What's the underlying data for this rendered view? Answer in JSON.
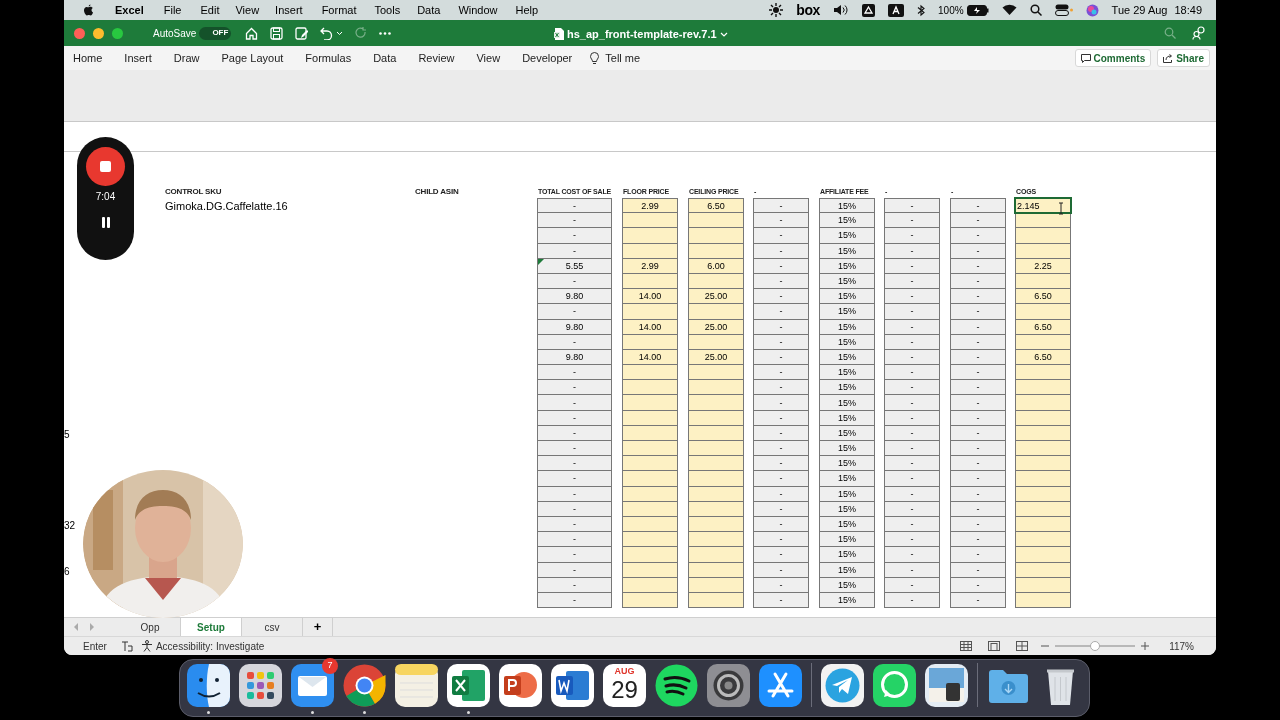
{
  "menu_bar": {
    "app": "Excel",
    "items": [
      "File",
      "Edit",
      "View",
      "Insert",
      "Format",
      "Tools",
      "Data",
      "Window",
      "Help"
    ],
    "status": {
      "box": "box",
      "battery": "100%",
      "date": "Tue 29 Aug",
      "time": "18:49"
    }
  },
  "title_bar": {
    "autosave_label": "AutoSave",
    "autosave_on": false,
    "autosave_state": "OFF",
    "title": "hs_ap_front-template-rev.7.1"
  },
  "ribbon_tabs": [
    "Home",
    "Insert",
    "Draw",
    "Page Layout",
    "Formulas",
    "Data",
    "Review",
    "View",
    "Developer"
  ],
  "tell_me": "Tell me",
  "comments_button": "Comments",
  "share_button": "Share",
  "recorder": {
    "elapsed": "7:04"
  },
  "edge_marks": [
    {
      "text": "5"
    },
    {
      "text": "32"
    },
    {
      "text": "6"
    }
  ],
  "sku": {
    "label": "CONTROL SKU",
    "value": "Gimoka.DG.Caffelatte.16"
  },
  "child_asin": {
    "label": "CHILD ASIN"
  },
  "table": {
    "columns": [
      {
        "header": "TOTAL COST OF SALE",
        "kind": "gray"
      },
      {
        "header": "FLOOR PRICE",
        "kind": "yellow"
      },
      {
        "header": "CEILING PRICE",
        "kind": "yellow"
      },
      {
        "header": "-",
        "kind": "gray"
      },
      {
        "header": "AFFILIATE FEE",
        "kind": "gray"
      },
      {
        "header": "-",
        "kind": "gray"
      },
      {
        "header": "-",
        "kind": "gray"
      },
      {
        "header": "COGS",
        "kind": "yellow"
      }
    ],
    "rows": [
      {
        "cells": [
          "-",
          "2.99",
          "6.50",
          "-",
          "15%",
          "-",
          "-",
          "2.145"
        ],
        "selected": true,
        "flagged": false
      },
      {
        "cells": [
          "-",
          null,
          null,
          "-",
          "15%",
          "-",
          "-",
          null
        ],
        "selected": false,
        "flagged": false
      },
      {
        "cells": [
          "-",
          null,
          null,
          "-",
          "15%",
          "-",
          "-",
          null
        ],
        "selected": false,
        "flagged": false
      },
      {
        "cells": [
          "-",
          null,
          null,
          "-",
          "15%",
          "-",
          "-",
          null
        ],
        "selected": false,
        "flagged": false
      },
      {
        "cells": [
          "5.55",
          "2.99",
          "6.00",
          "-",
          "15%",
          "-",
          "-",
          "2.25"
        ],
        "selected": false,
        "flagged": true
      },
      {
        "cells": [
          "-",
          null,
          null,
          "-",
          "15%",
          "-",
          "-",
          null
        ],
        "selected": false,
        "flagged": false
      },
      {
        "cells": [
          "9.80",
          "14.00",
          "25.00",
          "-",
          "15%",
          "-",
          "-",
          "6.50"
        ],
        "selected": false,
        "flagged": false
      },
      {
        "cells": [
          "-",
          null,
          null,
          "-",
          "15%",
          "-",
          "-",
          null
        ],
        "selected": false,
        "flagged": false
      },
      {
        "cells": [
          "9.80",
          "14.00",
          "25.00",
          "-",
          "15%",
          "-",
          "-",
          "6.50"
        ],
        "selected": false,
        "flagged": false
      },
      {
        "cells": [
          "-",
          null,
          null,
          "-",
          "15%",
          "-",
          "-",
          null
        ],
        "selected": false,
        "flagged": false
      },
      {
        "cells": [
          "9.80",
          "14.00",
          "25.00",
          "-",
          "15%",
          "-",
          "-",
          "6.50"
        ],
        "selected": false,
        "flagged": false
      },
      {
        "cells": [
          "-",
          null,
          null,
          "-",
          "15%",
          "-",
          "-",
          null
        ],
        "selected": false,
        "flagged": false
      },
      {
        "cells": [
          "-",
          null,
          null,
          "-",
          "15%",
          "-",
          "-",
          null
        ],
        "selected": false,
        "flagged": false
      },
      {
        "cells": [
          "-",
          null,
          null,
          "-",
          "15%",
          "-",
          "-",
          null
        ],
        "selected": false,
        "flagged": false
      },
      {
        "cells": [
          "-",
          null,
          null,
          "-",
          "15%",
          "-",
          "-",
          null
        ],
        "selected": false,
        "flagged": false
      },
      {
        "cells": [
          "-",
          null,
          null,
          "-",
          "15%",
          "-",
          "-",
          null
        ],
        "selected": false,
        "flagged": false
      },
      {
        "cells": [
          "-",
          null,
          null,
          "-",
          "15%",
          "-",
          "-",
          null
        ],
        "selected": false,
        "flagged": false
      },
      {
        "cells": [
          "-",
          null,
          null,
          "-",
          "15%",
          "-",
          "-",
          null
        ],
        "selected": false,
        "flagged": false
      },
      {
        "cells": [
          "-",
          null,
          null,
          "-",
          "15%",
          "-",
          "-",
          null
        ],
        "selected": false,
        "flagged": false
      },
      {
        "cells": [
          "-",
          null,
          null,
          "-",
          "15%",
          "-",
          "-",
          null
        ],
        "selected": false,
        "flagged": false
      },
      {
        "cells": [
          "-",
          null,
          null,
          "-",
          "15%",
          "-",
          "-",
          null
        ],
        "selected": false,
        "flagged": false
      },
      {
        "cells": [
          "-",
          null,
          null,
          "-",
          "15%",
          "-",
          "-",
          null
        ],
        "selected": false,
        "flagged": false
      },
      {
        "cells": [
          "-",
          null,
          null,
          "-",
          "15%",
          "-",
          "-",
          null
        ],
        "selected": false,
        "flagged": false
      },
      {
        "cells": [
          "-",
          null,
          null,
          "-",
          "15%",
          "-",
          "-",
          null
        ],
        "selected": false,
        "flagged": false
      },
      {
        "cells": [
          "-",
          null,
          null,
          "-",
          "15%",
          "-",
          "-",
          null
        ],
        "selected": false,
        "flagged": false
      },
      {
        "cells": [
          "-",
          null,
          null,
          "-",
          "15%",
          "-",
          "-",
          null
        ],
        "selected": false,
        "flagged": false
      },
      {
        "cells": [
          "-",
          null,
          null,
          "-",
          "15%",
          "-",
          "-",
          null
        ],
        "selected": false,
        "flagged": false
      }
    ]
  },
  "sheet_tabs": [
    {
      "label": "Opp",
      "selected": false
    },
    {
      "label": "Setup",
      "selected": true
    },
    {
      "label": "csv",
      "selected": false
    }
  ],
  "add_sheet": "+",
  "status_bar": {
    "mode": "Enter",
    "accessibility": "Accessibility: Investigate",
    "zoom": "117%",
    "zoom_slider": {
      "level": 0.5
    }
  },
  "dock": [
    {
      "kind": "finder",
      "running": true
    },
    {
      "kind": "launchpad",
      "running": false
    },
    {
      "kind": "mail",
      "running": true,
      "badge": "7"
    },
    {
      "kind": "chrome",
      "running": true
    },
    {
      "kind": "notes",
      "running": false
    },
    {
      "kind": "excel",
      "running": true
    },
    {
      "kind": "powerpoint",
      "running": false
    },
    {
      "kind": "word",
      "running": false
    },
    {
      "kind": "calendar",
      "running": false,
      "month": "AUG",
      "day": "29"
    },
    {
      "kind": "spotify",
      "running": false
    },
    {
      "kind": "settings",
      "running": false
    },
    {
      "kind": "appstore",
      "running": false
    },
    {
      "kind": "telegram",
      "running": false,
      "divider_before": true
    },
    {
      "kind": "whatsapp",
      "running": false
    },
    {
      "kind": "preview",
      "running": false
    },
    {
      "kind": "downloads",
      "running": false,
      "divider_before": true
    },
    {
      "kind": "trash",
      "running": false
    }
  ]
}
